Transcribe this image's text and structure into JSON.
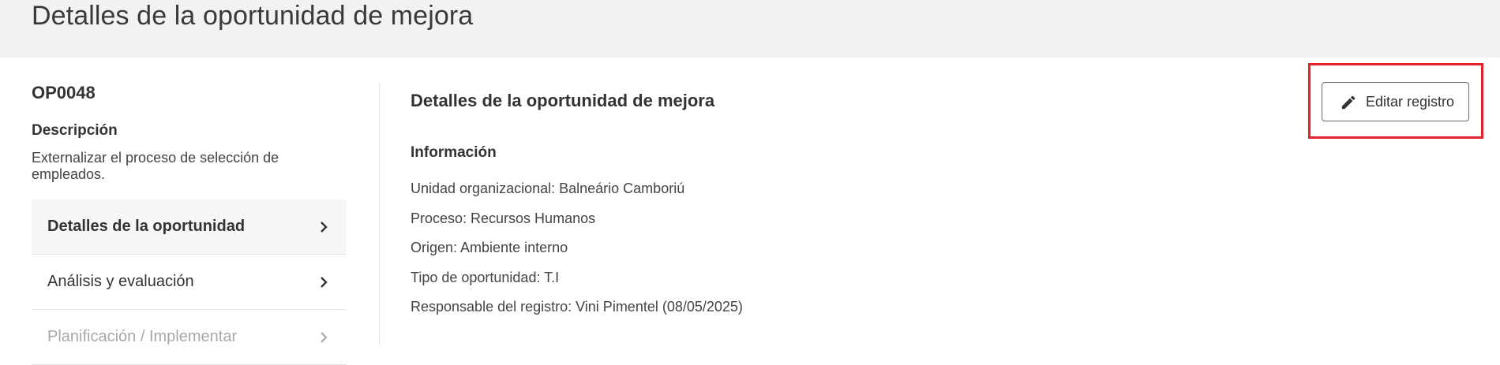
{
  "header": {
    "title": "Detalles de la oportunidad de mejora"
  },
  "record": {
    "id": "OP0048",
    "description_heading": "Descripción",
    "description": "Externalizar el proceso de selección de empleados."
  },
  "side_nav": {
    "items": [
      {
        "label": "Detalles de la oportunidad",
        "state": "active"
      },
      {
        "label": "Análisis y evaluación",
        "state": "enabled"
      },
      {
        "label": "Planificación / Implementar",
        "state": "disabled"
      }
    ]
  },
  "main": {
    "section_title": "Detalles de la oportunidad de mejora",
    "info_heading": "Información",
    "info_items": [
      "Unidad organizacional: Balneário Camboriú",
      "Proceso: Recursos Humanos",
      "Origen: Ambiente interno",
      "Tipo de oportunidad: T.I",
      "Responsable del registro: Vini Pimentel (08/05/2025)"
    ]
  },
  "actions": {
    "edit_label": "Editar registro",
    "edit_icon": "pencil-icon"
  },
  "colors": {
    "header_bg": "#f2f2f2",
    "highlight": "#e0242a",
    "text": "#333333",
    "disabled_text": "#a8a8a8"
  }
}
